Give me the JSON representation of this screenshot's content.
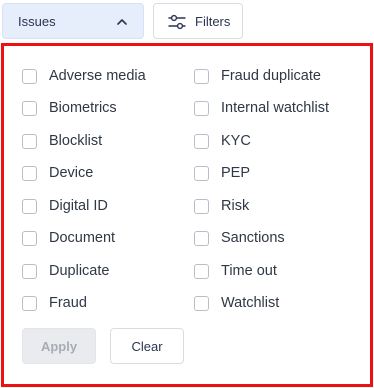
{
  "toolbar": {
    "issues_label": "Issues",
    "filters_label": "Filters"
  },
  "options": {
    "col1": [
      {
        "label": "Adverse media",
        "checked": false
      },
      {
        "label": "Biometrics",
        "checked": false
      },
      {
        "label": "Blocklist",
        "checked": false
      },
      {
        "label": "Device",
        "checked": false
      },
      {
        "label": "Digital ID",
        "checked": false
      },
      {
        "label": "Document",
        "checked": false
      },
      {
        "label": "Duplicate",
        "checked": false
      },
      {
        "label": "Fraud",
        "checked": false
      }
    ],
    "col2": [
      {
        "label": "Fraud duplicate",
        "checked": false
      },
      {
        "label": "Internal watchlist",
        "checked": false
      },
      {
        "label": "KYC",
        "checked": false
      },
      {
        "label": "PEP",
        "checked": false
      },
      {
        "label": "Risk",
        "checked": false
      },
      {
        "label": "Sanctions",
        "checked": false
      },
      {
        "label": "Time out",
        "checked": false
      },
      {
        "label": "Watchlist",
        "checked": false
      }
    ]
  },
  "actions": {
    "apply_label": "Apply",
    "apply_enabled": false,
    "clear_label": "Clear"
  },
  "colors": {
    "highlight_border": "#ee1111",
    "issues_button_bg": "#e6eefc",
    "apply_disabled_bg": "#e9ebee"
  },
  "icons": {
    "issues_toggle": "chevron-up-icon",
    "filters": "sliders-icon"
  }
}
